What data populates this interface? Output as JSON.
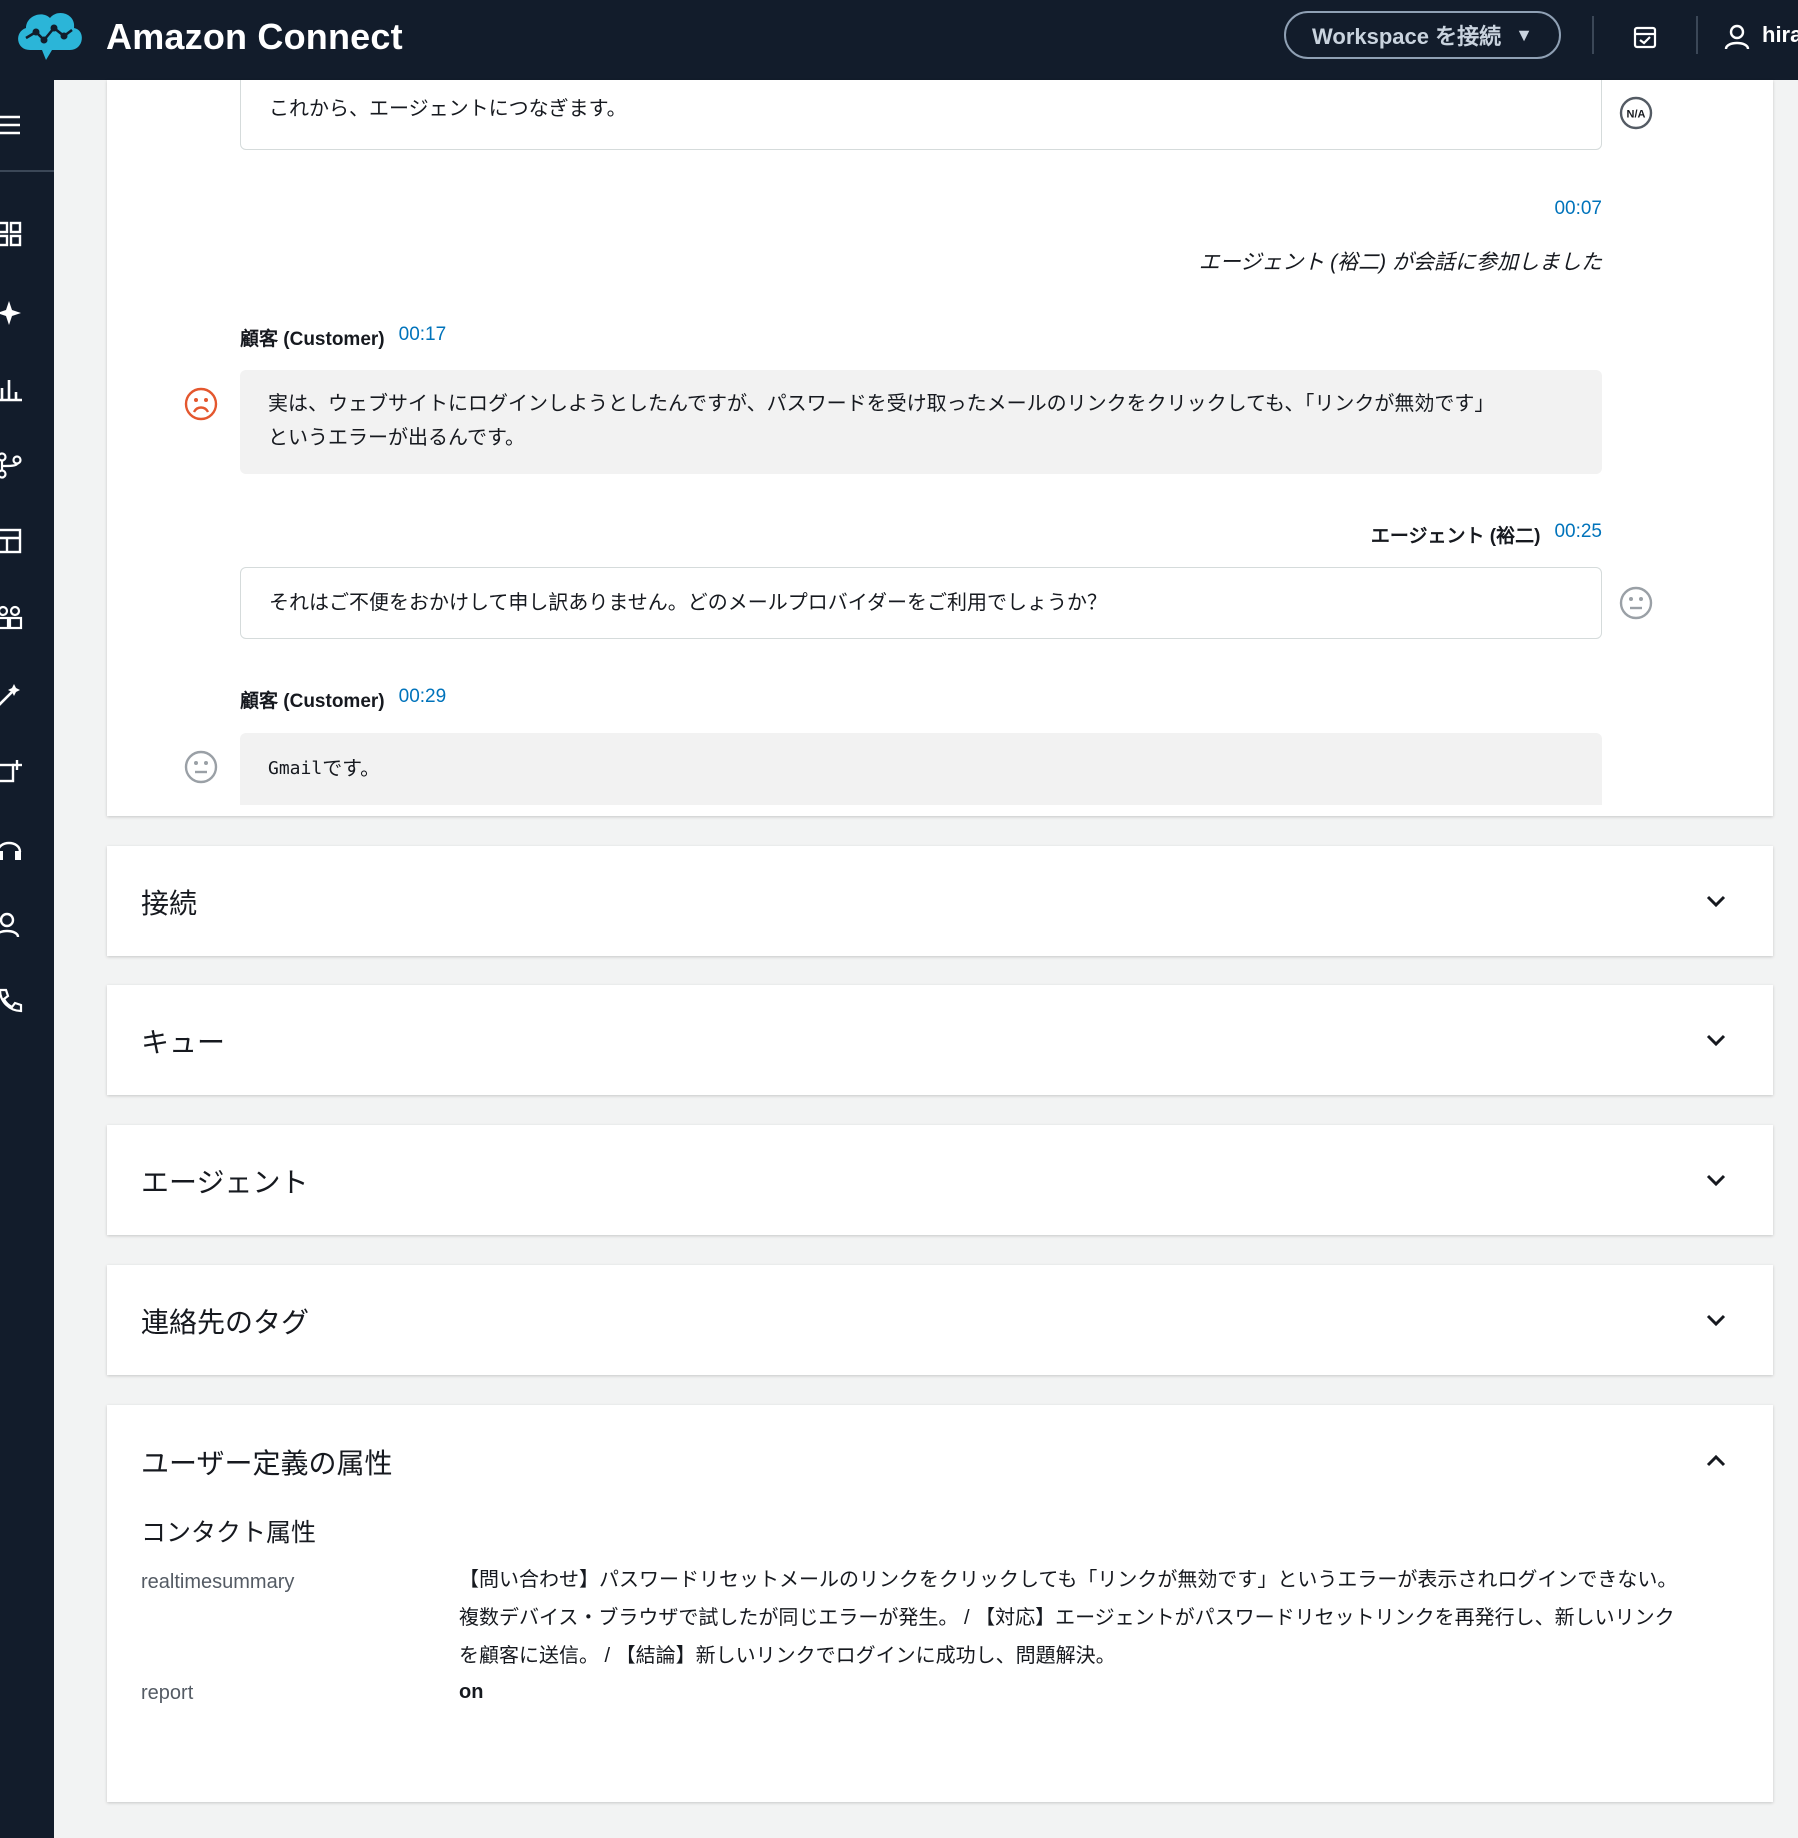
{
  "header": {
    "brand": "Amazon Connect",
    "workspace_button": "Workspace を接続",
    "workspace_caret": "▼",
    "user": "hira",
    "icons": [
      "amazon-connect-logo",
      "calendar-check-icon",
      "user-icon"
    ]
  },
  "sidebar": {
    "icons": [
      "menu-icon",
      "dashboard-icon",
      "sparkle-icon",
      "bar-chart-icon",
      "routing-icon",
      "table-icon",
      "users-icon",
      "magic-wand-icon",
      "channels-icon",
      "headset-icon",
      "user-icon",
      "phone-routing-icon"
    ]
  },
  "transcript": {
    "messages": [
      {
        "role": "agent",
        "text": "これから、エージェントにつなぎます。",
        "sentiment": "N/A"
      },
      {
        "role": "system",
        "time": "00:07",
        "text": "エージェント (裕二) が会話に参加しました"
      },
      {
        "role": "customer",
        "speaker": "顧客 (Customer)",
        "time": "00:17",
        "text_line1": "実は、ウェブサイトにログインしようとしたんですが、パスワードを受け取ったメールのリンクをクリックしても、「リンクが無効です」",
        "text_line2": "というエラーが出るんです。",
        "sentiment": "negative"
      },
      {
        "role": "agent",
        "speaker": "エージェント (裕二)",
        "time": "00:25",
        "text": "それはご不便をおかけして申し訳ありません。どのメールプロバイダーをご利用でしょうか？",
        "sentiment": "neutral"
      },
      {
        "role": "customer",
        "speaker": "顧客 (Customer)",
        "time": "00:29",
        "text_code": "Gmail",
        "text_rest": " です。",
        "sentiment": "neutral"
      }
    ]
  },
  "sections": [
    {
      "title": "接続",
      "expanded": false
    },
    {
      "title": "キュー",
      "expanded": false
    },
    {
      "title": "エージェント",
      "expanded": false
    },
    {
      "title": "連絡先のタグ",
      "expanded": false
    },
    {
      "title": "ユーザー定義の属性",
      "expanded": true
    }
  ],
  "attributes": {
    "heading": "コンタクト属性",
    "rows": [
      {
        "key": "realtimesummary",
        "line1": "【問い合わせ】パスワードリセットメールのリンクをクリックしても「リンクが無効です」というエラーが表示されログインできない。",
        "line2": "複数デバイス・ブラウザで試したが同じエラーが発生。 / 【対応】エージェントがパスワードリセットリンクを再発行し、新しいリンク",
        "line3": "を顧客に送信。 / 【結論】新しいリンクでログインに成功し、問題解決。"
      },
      {
        "key": "report",
        "value": "on"
      }
    ]
  },
  "colors": {
    "topbar": "#121c2b",
    "time": "#0073bb",
    "negative": "#e4572e",
    "neutral": "#9aa0a6"
  }
}
